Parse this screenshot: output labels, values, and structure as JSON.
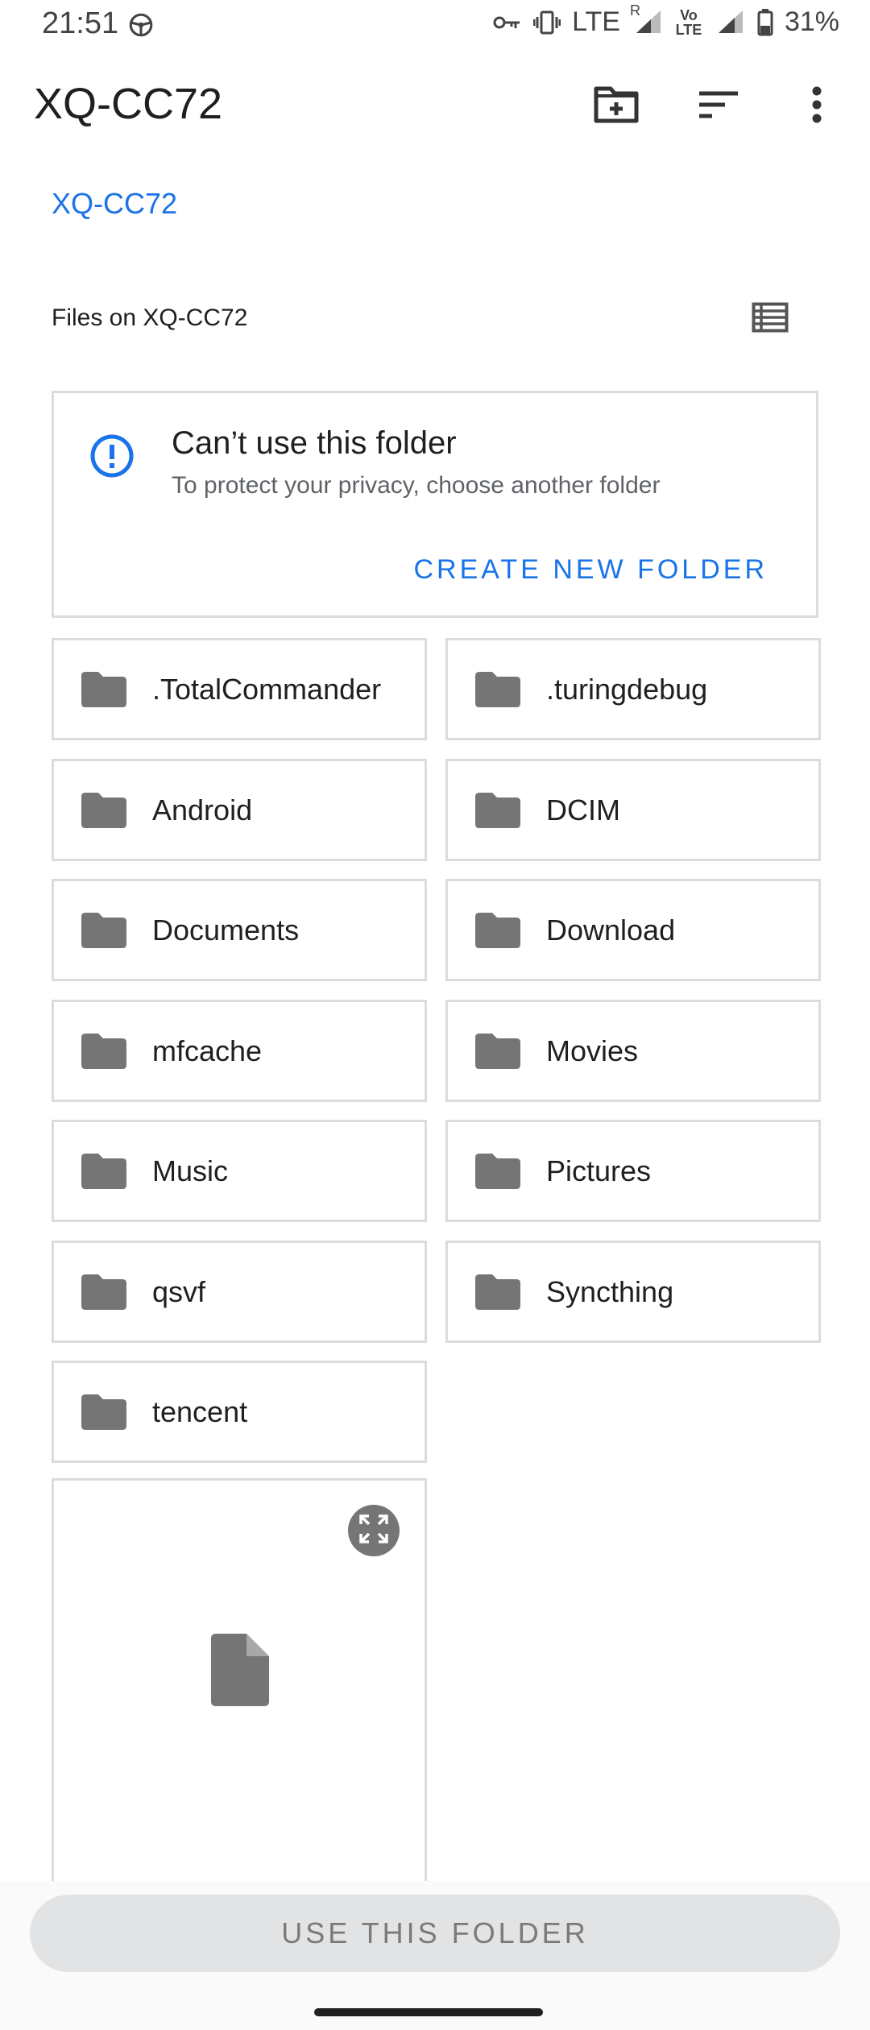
{
  "status_bar": {
    "time": "21:51",
    "lte_label": "LTE",
    "roaming_label": "R",
    "volte_label": "Vo LTE",
    "battery": "31%",
    "icons": [
      "steering-wheel-icon",
      "vpn-key-icon",
      "vibrate-icon",
      "signal-icon",
      "battery-icon"
    ]
  },
  "app_bar": {
    "title": "XQ-CC72",
    "icons": [
      "new-folder-icon",
      "sort-icon",
      "more-vert-icon"
    ]
  },
  "breadcrumb": "XQ-CC72",
  "section_header": "Files on XQ-CC72",
  "warning": {
    "title": "Can’t use this folder",
    "subtitle": "To protect your privacy, choose another folder",
    "action": "CREATE NEW FOLDER",
    "icon": "info-icon",
    "accent": "#1a73e8"
  },
  "folders": [
    ".TotalCommander",
    ".turingdebug",
    "Android",
    "DCIM",
    "Documents",
    "Download",
    "mfcache",
    "Movies",
    "Music",
    "Pictures",
    "qsvf",
    "Syncthing",
    "tencent"
  ],
  "file_card": {
    "icons": [
      "expand-icon",
      "document-icon"
    ]
  },
  "bottom_button": "USE THIS FOLDER",
  "colors": {
    "accent": "#1a73e8",
    "folder_icon": "#757575",
    "border": "#dadce0"
  }
}
